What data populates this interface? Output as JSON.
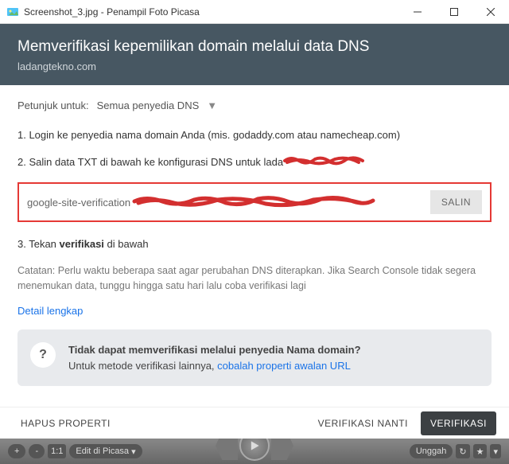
{
  "titlebar": {
    "filename": "Screenshot_3.jpg",
    "appname": "Penampil Foto Picasa",
    "title_full": "Screenshot_3.jpg - Penampil Foto Picasa"
  },
  "header": {
    "title": "Memverifikasi kepemilikan domain melalui data DNS",
    "subtitle": "ladangtekno.com"
  },
  "provider": {
    "label": "Petunjuk untuk:",
    "selected": "Semua penyedia DNS"
  },
  "steps": {
    "s1": "1. Login ke penyedia nama domain Anda (mis. godaddy.com atau namecheap.com)",
    "s2_prefix": "2. Salin data TXT di bawah ke konfigurasi DNS untuk ",
    "s2_domain_redacted": "lada",
    "s3_prefix": "3. Tekan ",
    "s3_bold": "verifikasi",
    "s3_suffix": " di bawah"
  },
  "codebox": {
    "value_prefix": "google-site-verification",
    "copy_btn": "SALIN"
  },
  "note": "Catatan: Perlu waktu beberapa saat agar perubahan DNS diterapkan. Jika Search Console tidak segera menemukan data, tunggu hingga satu hari lalu coba verifikasi lagi",
  "detail_link": "Detail lengkap",
  "infobox": {
    "q": "?",
    "title": "Tidak dapat memverifikasi melalui penyedia Nama domain?",
    "body_prefix": "Untuk metode verifikasi lainnya, ",
    "body_link": "cobalah properti awalan URL"
  },
  "footer": {
    "remove": "HAPUS PROPERTI",
    "later": "VERIFIKASI NANTI",
    "verify": "VERIFIKASI"
  },
  "picasabar": {
    "plus": "+",
    "minus": "-",
    "onetoone": "1:1",
    "edit": "Edit di Picasa",
    "upload": "Unggah",
    "star": "★",
    "more": "▾"
  }
}
